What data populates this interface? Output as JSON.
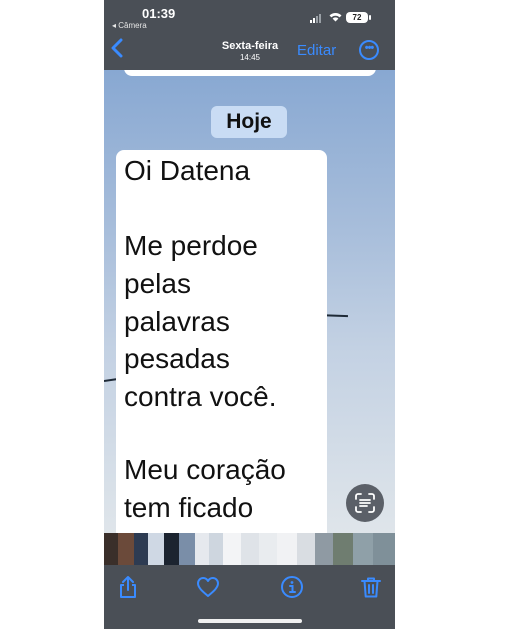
{
  "status_bar": {
    "time": "01:39",
    "back_app": "◂ Câmera",
    "battery": "72"
  },
  "nav": {
    "title_day": "Sexta-feira",
    "title_time": "14:45",
    "edit_label": "Editar"
  },
  "date_chip": "Hoje",
  "message_lines": [
    "Oi Datena",
    "Me perdoe",
    "pelas",
    "palavras",
    "pesadas",
    "contra você.",
    "Meu coração",
    "tem ficado"
  ],
  "colors": {
    "accent": "#3a8bff",
    "bar_bg": "#4a4f56"
  },
  "toolbar_icons": [
    "share-icon",
    "heart-icon",
    "info-icon",
    "trash-icon"
  ]
}
